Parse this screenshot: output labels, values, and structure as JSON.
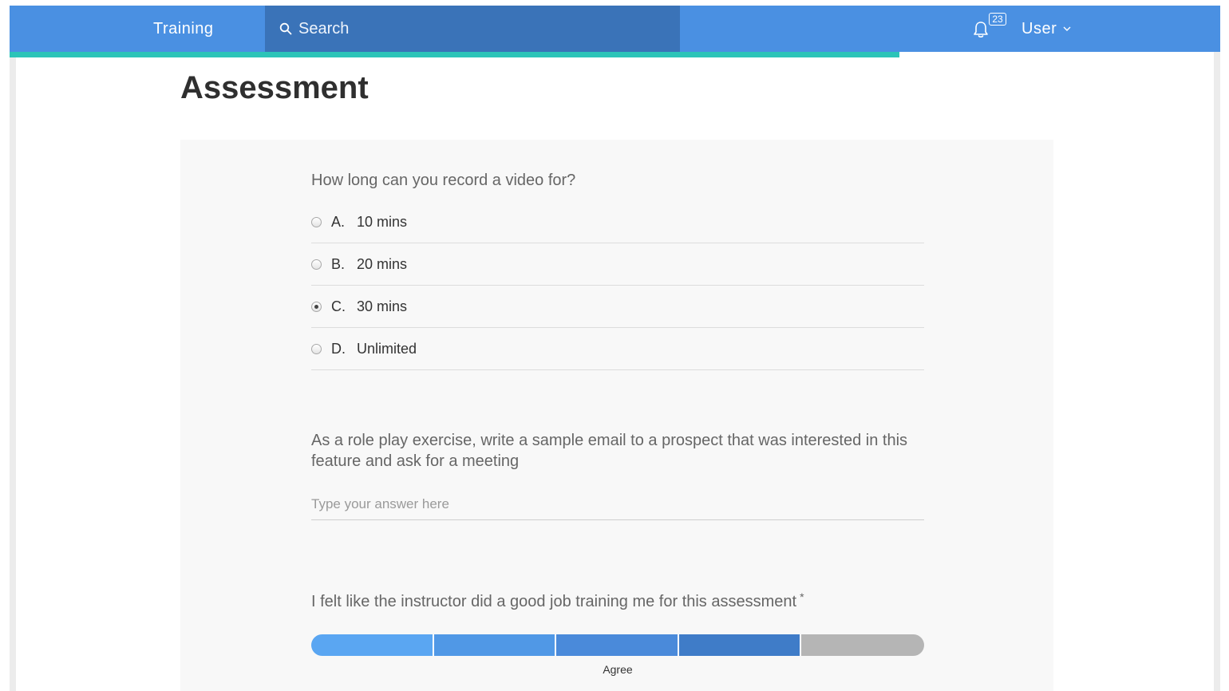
{
  "header": {
    "brand": "Training",
    "search_placeholder": "Search",
    "notification_count": "23",
    "user_label": "User"
  },
  "progress": {
    "fraction": 0.735
  },
  "page": {
    "title": "Assessment"
  },
  "questions": {
    "q1": {
      "prompt": "How long can you record a video for?",
      "options": [
        {
          "letter": "A.",
          "text": "10 mins",
          "selected": false
        },
        {
          "letter": "B.",
          "text": "20 mins",
          "selected": false
        },
        {
          "letter": "C.",
          "text": "30 mins",
          "selected": true
        },
        {
          "letter": "D.",
          "text": "Unlimited",
          "selected": false
        }
      ]
    },
    "q2": {
      "prompt": "As a role play exercise, write a sample email to a prospect that was interested in this feature and ask for a meeting",
      "placeholder": "Type your answer here",
      "value": ""
    },
    "q3": {
      "prompt": "I felt like the instructor did a good job training me for this assessment",
      "required_mark": "*",
      "scale_level": 4,
      "scale_max": 5,
      "selected_label": "Agree"
    }
  },
  "colors": {
    "header_bg": "#4a90e2",
    "search_bg": "#3a73b8",
    "progress": "#2cc4b8",
    "scale_active": [
      "#5aa6f2",
      "#5098e6",
      "#4a8ada",
      "#3f7cc8"
    ],
    "scale_inactive": "#b5b5b5"
  },
  "icons": {
    "search": "search-icon",
    "bell": "bell-icon",
    "chevron": "chevron-down-icon"
  }
}
